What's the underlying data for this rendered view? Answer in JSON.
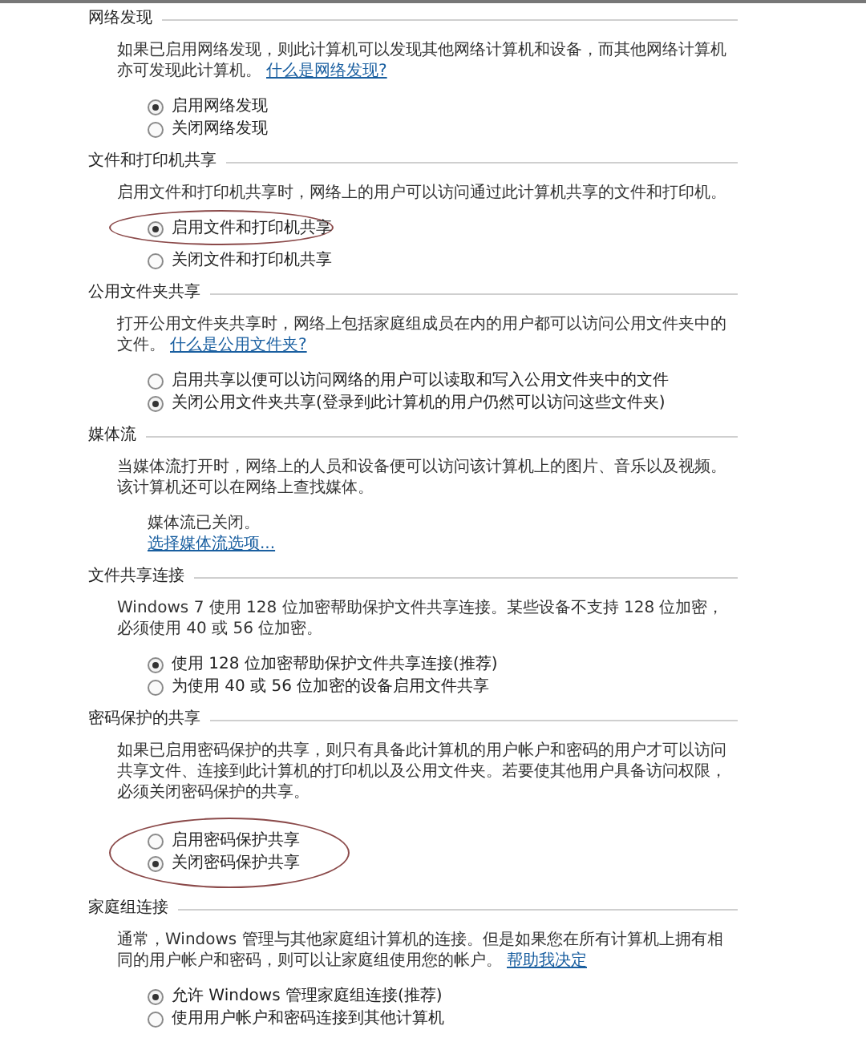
{
  "sections": [
    {
      "title": "网络发现",
      "description": "如果已启用网络发现，则此计算机可以发现其他网络计算机和设备，而其他网络计算机亦可发现此计算机。",
      "link": "什么是网络发现?",
      "options": [
        {
          "label": "启用网络发现",
          "selected": true,
          "circled": false
        },
        {
          "label": "关闭网络发现",
          "selected": false,
          "circled": false
        }
      ]
    },
    {
      "title": "文件和打印机共享",
      "description": "启用文件和打印机共享时，网络上的用户可以访问通过此计算机共享的文件和打印机。",
      "options": [
        {
          "label": "启用文件和打印机共享",
          "selected": true,
          "circled": true
        },
        {
          "label": "关闭文件和打印机共享",
          "selected": false,
          "circled": false
        }
      ]
    },
    {
      "title": "公用文件夹共享",
      "description": "打开公用文件夹共享时，网络上包括家庭组成员在内的用户都可以访问公用文件夹中的文件。",
      "link": "什么是公用文件夹?",
      "options": [
        {
          "label": "启用共享以便可以访问网络的用户可以读取和写入公用文件夹中的文件",
          "selected": false,
          "circled": false
        },
        {
          "label": "关闭公用文件夹共享(登录到此计算机的用户仍然可以访问这些文件夹)",
          "selected": true,
          "circled": false
        }
      ]
    },
    {
      "title": "媒体流",
      "description": "当媒体流打开时，网络上的人员和设备便可以访问该计算机上的图片、音乐以及视频。该计算机还可以在网络上查找媒体。",
      "status": "媒体流已关闭。",
      "status_link": "选择媒体流选项..."
    },
    {
      "title": "文件共享连接",
      "description": "Windows 7 使用 128 位加密帮助保护文件共享连接。某些设备不支持 128 位加密，必须使用 40 或 56 位加密。",
      "options": [
        {
          "label": "使用 128 位加密帮助保护文件共享连接(推荐)",
          "selected": true,
          "circled": false
        },
        {
          "label": "为使用 40 或 56 位加密的设备启用文件共享",
          "selected": false,
          "circled": false
        }
      ]
    },
    {
      "title": "密码保护的共享",
      "description": "如果已启用密码保护的共享，则只有具备此计算机的用户帐户和密码的用户才可以访问共享文件、连接到此计算机的打印机以及公用文件夹。若要使其他用户具备访问权限，必须关闭密码保护的共享。",
      "options": [
        {
          "label": "启用密码保护共享",
          "selected": false,
          "circled": true
        },
        {
          "label": "关闭密码保护共享",
          "selected": true,
          "circled": true
        }
      ]
    },
    {
      "title": "家庭组连接",
      "description": "通常，Windows 管理与其他家庭组计算机的连接。但是如果您在所有计算机上拥有相同的用户帐户和密码，则可以让家庭组使用您的帐户。",
      "link": "帮助我决定",
      "options": [
        {
          "label": "允许 Windows 管理家庭组连接(推荐)",
          "selected": true,
          "circled": false
        },
        {
          "label": "使用用户帐户和密码连接到其他计算机",
          "selected": false,
          "circled": false
        }
      ]
    }
  ]
}
